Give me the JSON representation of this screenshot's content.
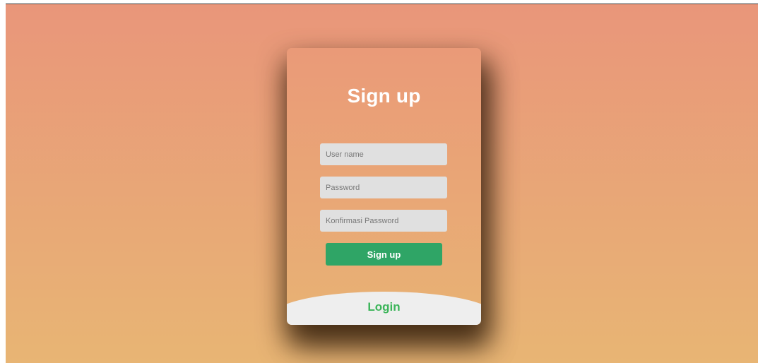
{
  "signup_form": {
    "title": "Sign up",
    "username_placeholder": "User name",
    "password_placeholder": "Password",
    "confirm_placeholder": "Konfirmasi Password",
    "submit_label": "Sign up",
    "login_link": "Login"
  },
  "colors": {
    "background_top": "#e9967a",
    "background_bottom": "#e8b574",
    "button": "#2fa566",
    "login_link": "#3cb55a",
    "input_bg": "#e0e0e0"
  }
}
